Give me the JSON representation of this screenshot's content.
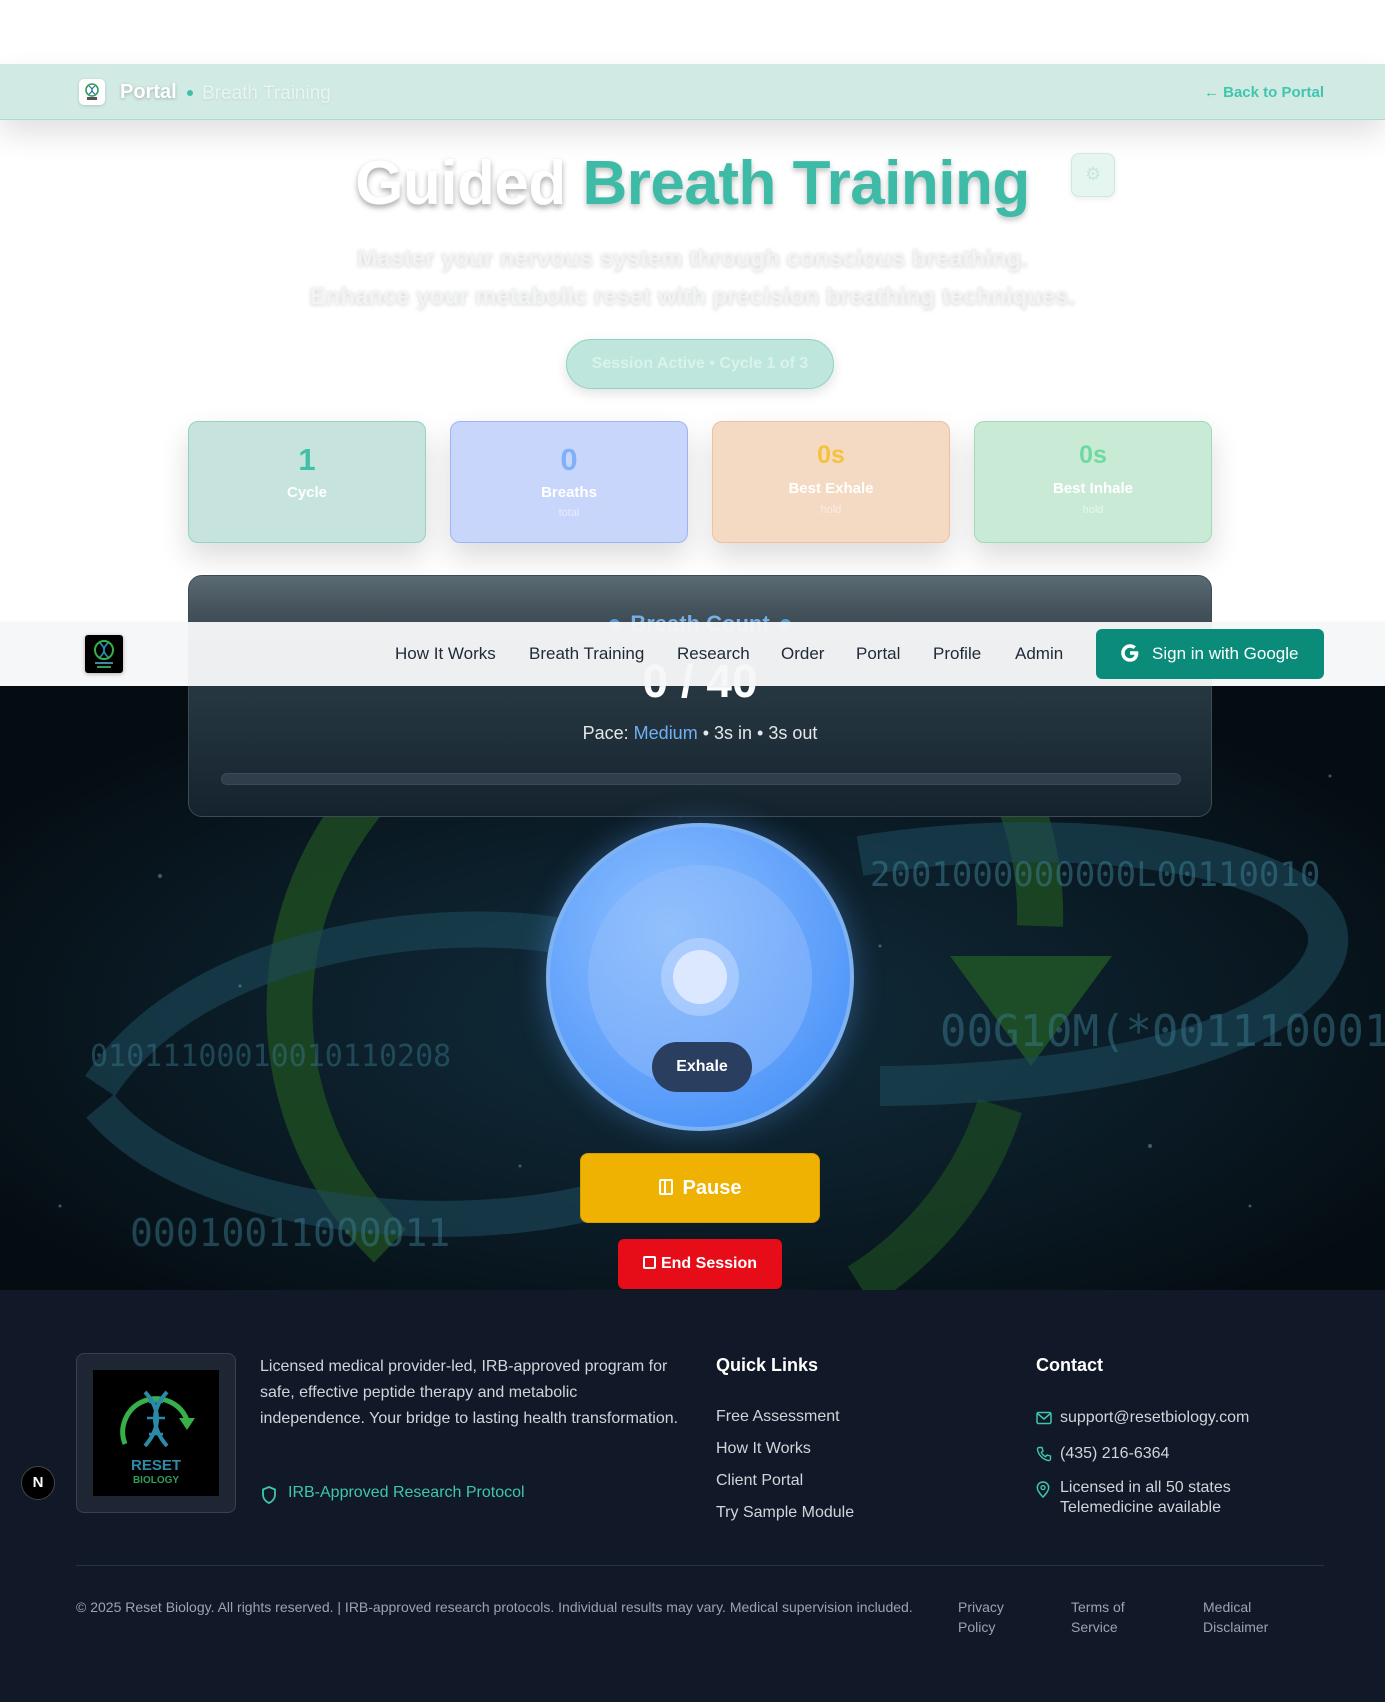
{
  "portal_header": {
    "title": "Portal",
    "breadcrumb": "Breath Training",
    "back_link": "← Back to Portal"
  },
  "hero": {
    "title_part1": "Guided",
    "title_part2": "Breath Training",
    "subtitle_line1": "Master your nervous system through conscious breathing.",
    "subtitle_line2": "Enhance your metabolic reset with precision breathing techniques.",
    "session_status": "Session Active • Cycle 1 of 3",
    "settings_icon": "gear-icon"
  },
  "stats": [
    {
      "value": "1",
      "label": "Cycle",
      "sub": ""
    },
    {
      "value": "0",
      "label": "Breaths",
      "sub": "total"
    },
    {
      "value": "0s",
      "label": "Best Exhale",
      "sub": "hold"
    },
    {
      "value": "0s",
      "label": "Best Inhale",
      "sub": "hold"
    }
  ],
  "breath_count": {
    "heading": "Breath Count",
    "count": "0 / 40",
    "pace_label": "Pace:",
    "pace_value": "Medium",
    "pace_detail": " • 3s in • 3s out",
    "progress": 0
  },
  "nav": {
    "logo": "reset-biology-logo",
    "links": [
      "How It Works",
      "Breath Training",
      "Research",
      "Order",
      "Portal",
      "Profile",
      "Admin"
    ],
    "signin_label": "Sign in with Google"
  },
  "orb": {
    "phase": "Exhale"
  },
  "controls": {
    "pause_label": "Pause",
    "end_label": "End Session"
  },
  "footer": {
    "logo_text_1": "RESET",
    "logo_text_2": "BIOLOGY",
    "description": "Licensed medical provider-led, IRB-approved program for safe, effective peptide therapy and metabolic independence. Your bridge to lasting health transformation.",
    "irb_badge": "IRB-Approved Research Protocol",
    "quick_links_heading": "Quick Links",
    "quick_links": [
      "Free Assessment",
      "How It Works",
      "Client Portal",
      "Try Sample Module"
    ],
    "contact_heading": "Contact",
    "email": "support@resetbiology.com",
    "phone": "(435) 216-6364",
    "licensed_line1": "Licensed in all 50 states",
    "licensed_line2": "Telemedicine available",
    "copyright": "© 2025 Reset Biology. All rights reserved. | IRB-approved research protocols. Individual results may vary. Medical supervision included.",
    "legal": [
      "Privacy Policy",
      "Terms of Service",
      "Medical Disclaimer"
    ]
  },
  "badge": "N",
  "colors": {
    "accent_teal": "#3dbba6",
    "nav_button": "#0b8c7a",
    "pause": "#efb202",
    "end": "#e60d18",
    "orb_blue": "#3c8af6",
    "footer_bg": "#111827"
  }
}
